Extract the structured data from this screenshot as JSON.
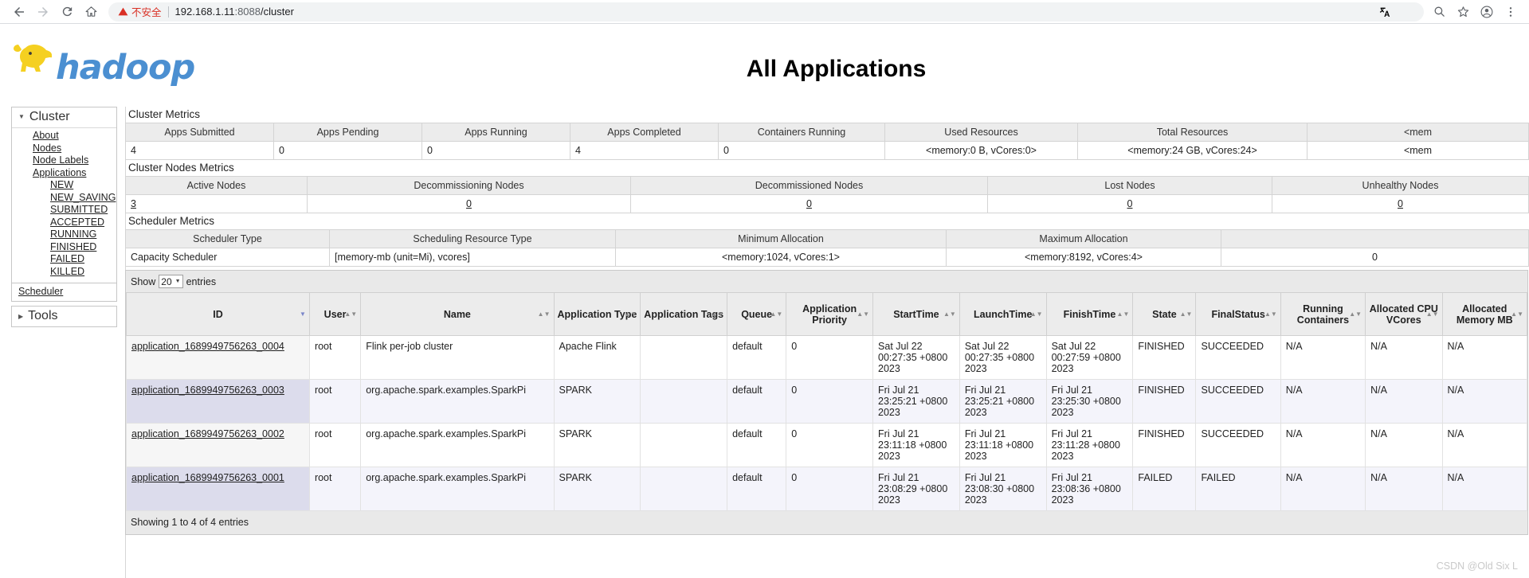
{
  "browser": {
    "back_icon": "back-arrow-icon",
    "forward_icon": "forward-arrow-icon",
    "reload_icon": "reload-icon",
    "home_icon": "home-icon",
    "security_label": "不安全",
    "url_host": "192.168.1.11",
    "url_port": ":8088",
    "url_path": "/cluster",
    "translate_icon": "translate-icon",
    "search_icon": "search-icon",
    "bookmark_icon": "star-icon",
    "profile_icon": "profile-icon",
    "menu_icon": "kebab-menu-icon"
  },
  "brand": {
    "wordmark": "hadoop",
    "logo_icon": "hadoop-elephant-logo",
    "color": "#4b8fd1"
  },
  "header": {
    "title": "All Applications"
  },
  "sidebar": {
    "cluster_label": "Cluster",
    "cluster_links": [
      {
        "label": "About"
      },
      {
        "label": "Nodes"
      },
      {
        "label": "Node Labels"
      },
      {
        "label": "Applications"
      }
    ],
    "app_states": [
      {
        "label": "NEW"
      },
      {
        "label": "NEW_SAVING"
      },
      {
        "label": "SUBMITTED"
      },
      {
        "label": "ACCEPTED"
      },
      {
        "label": "RUNNING"
      },
      {
        "label": "FINISHED"
      },
      {
        "label": "FAILED"
      },
      {
        "label": "KILLED"
      }
    ],
    "scheduler_label": "Scheduler",
    "tools_label": "Tools"
  },
  "cluster_metrics": {
    "section_title": "Cluster Metrics",
    "headers": [
      "Apps Submitted",
      "Apps Pending",
      "Apps Running",
      "Apps Completed",
      "Containers Running",
      "Used Resources",
      "Total Resources",
      "<mem"
    ],
    "values": [
      "4",
      "0",
      "0",
      "4",
      "0",
      "<memory:0 B, vCores:0>",
      "<memory:24 GB, vCores:24>",
      "<mem"
    ]
  },
  "nodes_metrics": {
    "section_title": "Cluster Nodes Metrics",
    "headers": [
      "Active Nodes",
      "Decommissioning Nodes",
      "Decommissioned Nodes",
      "Lost Nodes",
      "Unhealthy Nodes"
    ],
    "values": [
      "3",
      "0",
      "0",
      "0",
      "0"
    ]
  },
  "scheduler_metrics": {
    "section_title": "Scheduler Metrics",
    "headers": [
      "Scheduler Type",
      "Scheduling Resource Type",
      "Minimum Allocation",
      "Maximum Allocation",
      ""
    ],
    "values": [
      "Capacity Scheduler",
      "[memory-mb (unit=Mi), vcores]",
      "<memory:1024, vCores:1>",
      "<memory:8192, vCores:4>",
      "0"
    ]
  },
  "apps_table": {
    "show_label": "Show",
    "show_value": "20",
    "entries_label": "entries",
    "columns": [
      "ID",
      "User",
      "Name",
      "Application Type",
      "Application Tags",
      "Queue",
      "Application Priority",
      "StartTime",
      "LaunchTime",
      "FinishTime",
      "State",
      "FinalStatus",
      "Running Containers",
      "Allocated CPU VCores",
      "Allocated Memory MB"
    ],
    "rows": [
      {
        "id": "application_1689949756263_0004",
        "user": "root",
        "name": "Flink per-job cluster",
        "type": "Apache Flink",
        "tags": "",
        "queue": "default",
        "priority": "0",
        "start_time": "Sat Jul 22 00:27:35 +0800 2023",
        "launch_time": "Sat Jul 22 00:27:35 +0800 2023",
        "finish_time": "Sat Jul 22 00:27:59 +0800 2023",
        "state": "FINISHED",
        "final_status": "SUCCEEDED",
        "running_containers": "N/A",
        "alloc_vcores": "N/A",
        "alloc_memory": "N/A"
      },
      {
        "id": "application_1689949756263_0003",
        "user": "root",
        "name": "org.apache.spark.examples.SparkPi",
        "type": "SPARK",
        "tags": "",
        "queue": "default",
        "priority": "0",
        "start_time": "Fri Jul 21 23:25:21 +0800 2023",
        "launch_time": "Fri Jul 21 23:25:21 +0800 2023",
        "finish_time": "Fri Jul 21 23:25:30 +0800 2023",
        "state": "FINISHED",
        "final_status": "SUCCEEDED",
        "running_containers": "N/A",
        "alloc_vcores": "N/A",
        "alloc_memory": "N/A"
      },
      {
        "id": "application_1689949756263_0002",
        "user": "root",
        "name": "org.apache.spark.examples.SparkPi",
        "type": "SPARK",
        "tags": "",
        "queue": "default",
        "priority": "0",
        "start_time": "Fri Jul 21 23:11:18 +0800 2023",
        "launch_time": "Fri Jul 21 23:11:18 +0800 2023",
        "finish_time": "Fri Jul 21 23:11:28 +0800 2023",
        "state": "FINISHED",
        "final_status": "SUCCEEDED",
        "running_containers": "N/A",
        "alloc_vcores": "N/A",
        "alloc_memory": "N/A"
      },
      {
        "id": "application_1689949756263_0001",
        "user": "root",
        "name": "org.apache.spark.examples.SparkPi",
        "type": "SPARK",
        "tags": "",
        "queue": "default",
        "priority": "0",
        "start_time": "Fri Jul 21 23:08:29 +0800 2023",
        "launch_time": "Fri Jul 21 23:08:30 +0800 2023",
        "finish_time": "Fri Jul 21 23:08:36 +0800 2023",
        "state": "FAILED",
        "final_status": "FAILED",
        "running_containers": "N/A",
        "alloc_vcores": "N/A",
        "alloc_memory": "N/A"
      }
    ],
    "footer": "Showing 1 to 4 of 4 entries"
  },
  "watermark": "CSDN @Old Six L"
}
